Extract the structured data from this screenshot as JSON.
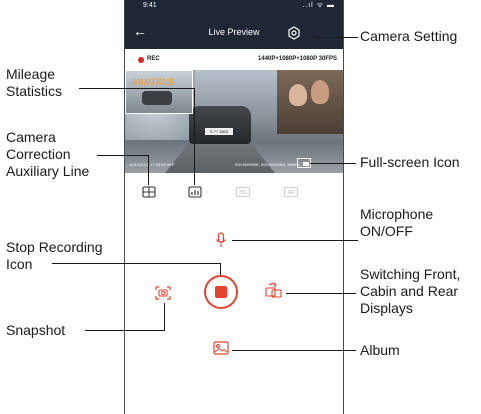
{
  "status_bar": {
    "time": "9:41",
    "icons": "..ıl ᯤ ▬"
  },
  "header": {
    "title": "Live Preview"
  },
  "rec_bar": {
    "rec_label": "REC",
    "resolution": "1440P+1080P+1080P 30FPS"
  },
  "video": {
    "brand": "VANTRUE",
    "plate": "S ?? 3803",
    "date_overlay": "10/10/2022 17:53:49 0KP",
    "gps_overlay": "000.000000E, 000.000000N, 369KH"
  },
  "toolbar": {
    "hd_label": "HD",
    "ar_label": "AR"
  },
  "annotations": {
    "camera_setting": "Camera Setting",
    "mileage": [
      "Mileage",
      "Statistics"
    ],
    "correction": [
      "Camera",
      "Correction",
      "Auxiliary Line"
    ],
    "fullscreen": "Full-screen Icon",
    "microphone": [
      "Microphone",
      "ON/OFF"
    ],
    "stop": [
      "Stop Recording",
      "Icon"
    ],
    "switching": [
      "Switching Front,",
      "Cabin and Rear",
      "Displays"
    ],
    "snapshot": "Snapshot",
    "album": "Album"
  },
  "colors": {
    "header_bg": "#1f2734",
    "accent": "#e5432f",
    "rec_dot": "#e0251b"
  }
}
